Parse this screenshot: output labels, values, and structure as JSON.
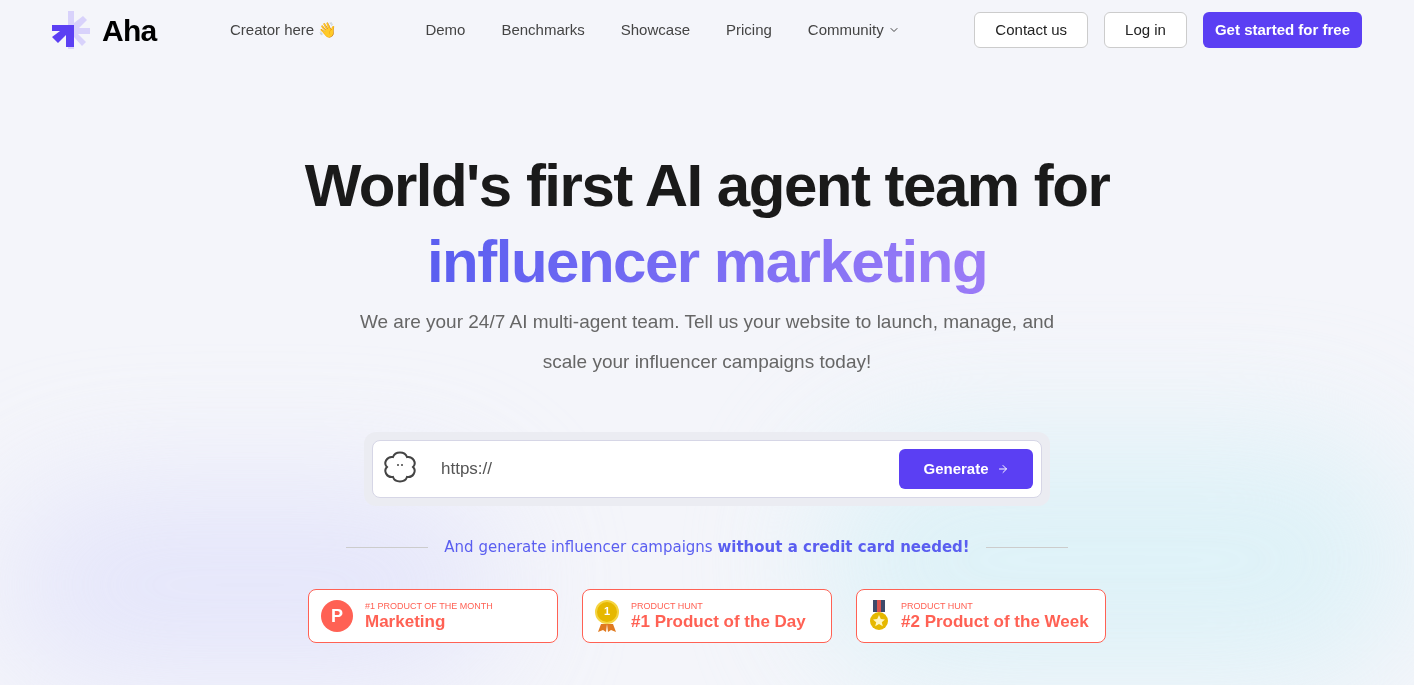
{
  "logo": {
    "text": "Aha"
  },
  "creator_link": "Creator here 👋",
  "nav": [
    {
      "label": "Demo",
      "dropdown": false
    },
    {
      "label": "Benchmarks",
      "dropdown": false
    },
    {
      "label": "Showcase",
      "dropdown": false
    },
    {
      "label": "Pricing",
      "dropdown": false
    },
    {
      "label": "Community",
      "dropdown": true
    }
  ],
  "actions": [
    {
      "label": "Contact us",
      "kind": "outline"
    },
    {
      "label": "Log in",
      "kind": "outline"
    },
    {
      "label": "Get started for free",
      "kind": "primary"
    }
  ],
  "hero": {
    "title": "World's first AI agent team for",
    "title_highlight": "influencer marketing",
    "subtitle": "We are your 24/7 AI multi-agent team. Tell us your website to launch, manage, and scale your influencer campaigns today!"
  },
  "url_form": {
    "placeholder": "https://",
    "button": "Generate"
  },
  "note": "And generate influencer campaigns **without a credit card needed!**",
  "badges": [
    {
      "kind": "logo",
      "icon_text": "P",
      "overline": "#1 PRODUCT OF THE MONTH",
      "title": "Marketing"
    },
    {
      "kind": "gold-medal",
      "icon_text": "1",
      "overline": "PRODUCT HUNT",
      "title": "#1 Product of the Day"
    },
    {
      "kind": "star-medal",
      "overline": "PRODUCT HUNT",
      "title": "#2 Product of the Week"
    }
  ]
}
